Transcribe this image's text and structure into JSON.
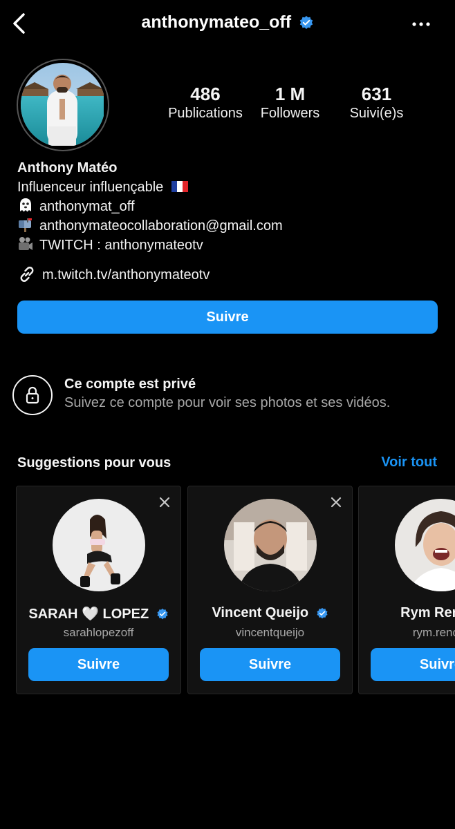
{
  "header": {
    "username": "anthonymateo_off",
    "back_icon": "chevron-left-icon",
    "more_icon": "more-horizontal-icon"
  },
  "stats": [
    {
      "value": "486",
      "label": "Publications"
    },
    {
      "value": "1 M",
      "label": "Followers"
    },
    {
      "value": "631",
      "label": "Suivi(e)s"
    }
  ],
  "bio": {
    "name": "Anthony Matéo",
    "tagline": "Influenceur influençable",
    "snapchat": "anthonymat_off",
    "email": "anthonymateocollaboration@gmail.com",
    "twitch": "TWITCH : anthonymateotv",
    "link": "m.twitch.tv/anthonymateotv"
  },
  "follow_button": "Suivre",
  "private": {
    "title": "Ce compte est privé",
    "subtitle": "Suivez ce compte pour voir ses photos et ses vidéos."
  },
  "suggestions": {
    "title": "Suggestions pour vous",
    "see_all": "Voir tout",
    "cards": [
      {
        "name": "SARAH 🤍 LOPEZ",
        "handle": "sarahlopezoff",
        "button": "Suivre",
        "verified": true
      },
      {
        "name": "Vincent Queijo",
        "handle": "vincentqueijo",
        "button": "Suivre",
        "verified": true
      },
      {
        "name": "Rym Renom",
        "handle": "rym.renom",
        "button": "Suivre",
        "verified": false
      }
    ]
  },
  "colors": {
    "accent": "#1a94f5",
    "verified": "#3897f0",
    "background": "#000000",
    "muted_text": "#a8a8a8"
  }
}
